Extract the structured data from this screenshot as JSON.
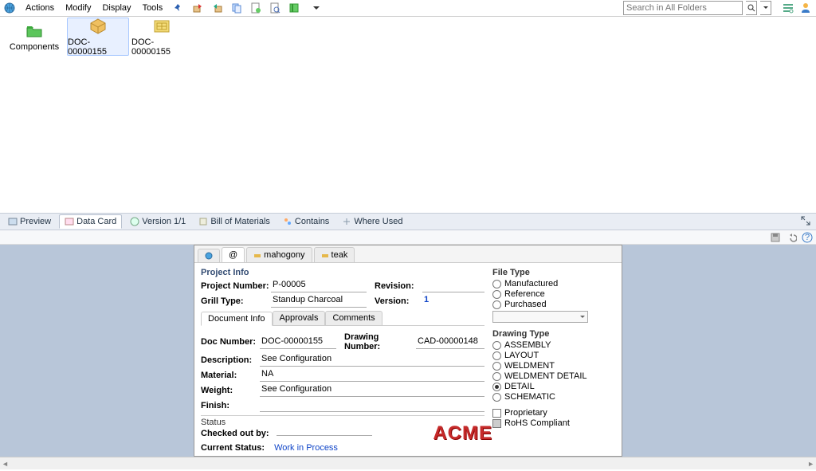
{
  "menu": {
    "actions": "Actions",
    "modify": "Modify",
    "display": "Display",
    "tools": "Tools"
  },
  "search": {
    "placeholder": "Search in All Folders"
  },
  "items": [
    {
      "label": "Components"
    },
    {
      "label": "DOC-00000155"
    },
    {
      "label": "DOC-00000155"
    }
  ],
  "tabs": {
    "preview": "Preview",
    "datacard": "Data Card",
    "version": "Version 1/1",
    "bom": "Bill of Materials",
    "contains": "Contains",
    "whereused": "Where Used"
  },
  "cardtabs": {
    "at": "@",
    "mahogony": "mahogony",
    "teak": "teak"
  },
  "project": {
    "title": "Project Info",
    "projectNumberLabel": "Project Number:",
    "projectNumber": "P-00005",
    "grillTypeLabel": "Grill Type:",
    "grillType": "Standup Charcoal",
    "revisionLabel": "Revision:",
    "revision": "",
    "versionLabel": "Version:",
    "version": "1"
  },
  "innerTabs": {
    "docinfo": "Document Info",
    "approvals": "Approvals",
    "comments": "Comments"
  },
  "doc": {
    "docNumberLabel": "Doc Number:",
    "docNumber": "DOC-00000155",
    "drawingNumberLabel": "Drawing Number:",
    "drawingNumber": "CAD-00000148",
    "descriptionLabel": "Description:",
    "description": "See Configuration",
    "materialLabel": "Material:",
    "material": "NA",
    "weightLabel": "Weight:",
    "weight": "See Configuration",
    "finishLabel": "Finish:",
    "finish": ""
  },
  "status": {
    "statusLabel": "Status",
    "checkedOutByLabel": "Checked out by:",
    "checkedOutBy": "",
    "currentStatusLabel": "Current Status:",
    "currentStatus": "Work in Process"
  },
  "logo": "ACME",
  "fileType": {
    "title": "File Type",
    "manufactured": "Manufactured",
    "reference": "Reference",
    "purchased": "Purchased"
  },
  "drawingType": {
    "title": "Drawing Type",
    "assembly": "ASSEMBLY",
    "layout": "LAYOUT",
    "weldment": "WELDMENT",
    "weldmentDetail": "WELDMENT DETAIL",
    "detail": "DETAIL",
    "schematic": "SCHEMATIC"
  },
  "compliance": {
    "proprietary": "Proprietary",
    "rohs": "RoHS Compliant"
  }
}
